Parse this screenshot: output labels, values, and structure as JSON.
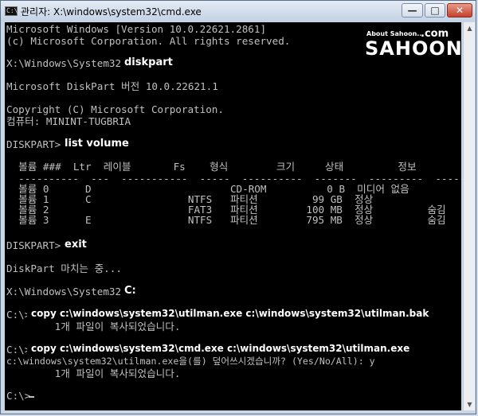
{
  "window": {
    "icon_text": "C:\\",
    "title": "관리자: X:\\windows\\system32\\cmd.exe",
    "min_label": "—",
    "max_label": "□",
    "close_label": "✕"
  },
  "console": {
    "lines": [
      "Microsoft Windows [Version 10.0.22621.2861]",
      "(c) Microsoft Corporation. All rights reserved.",
      "X:\\Windows\\System32>",
      "Microsoft DiskPart 버전 10.0.22621.1",
      "Copyright (C) Microsoft Corporation.",
      "컴퓨터: MININT-TUGBRIA",
      "DISKPART>",
      "  볼륨 ###  Ltr  레이블       Fs    형식        크기     상태         정보",
      "  ----------  ---  -----------  -----  ----------  -------  ---------  --------",
      "  볼륨 0      D                       CD-ROM          0 B  미디어 없음",
      "  볼륨 1      C                NTFS   파티션         99 GB  정상",
      "  볼륨 2                       FAT3   파티션        100 MB  정상         숨김",
      "  볼륨 3      E                NTFS   파티션        795 MB  정상         숨김",
      "DISKPART>",
      "DiskPart 마치는 중...",
      "X:\\Windows\\System32>",
      "C:\\>",
      "        1개 파일이 복사되었습니다.",
      "C:\\>",
      "c:\\windows\\system32\\utilman.exe을(를) 덮어쓰시겠습니까? (Yes/No/All): y",
      "        1개 파일이 복사되었습니다.",
      "C:\\>"
    ],
    "commands": {
      "diskpart": "diskpart",
      "list_volume": "list volume",
      "exit": "exit",
      "drive_c": "C:",
      "copy_backup": "copy c:\\windows\\system32\\utilman.exe c:\\windows\\system32\\utilman.bak",
      "copy_cmd": "copy c:\\windows\\system32\\cmd.exe c:\\windows\\system32\\utilman.exe"
    }
  },
  "watermark": {
    "about": "About Sahoon...",
    "com": ".com",
    "brand": "SAHOON"
  },
  "colors": {
    "console_bg": "#000000",
    "console_text": "#c0c0c0",
    "command_text": "#ffffff"
  }
}
